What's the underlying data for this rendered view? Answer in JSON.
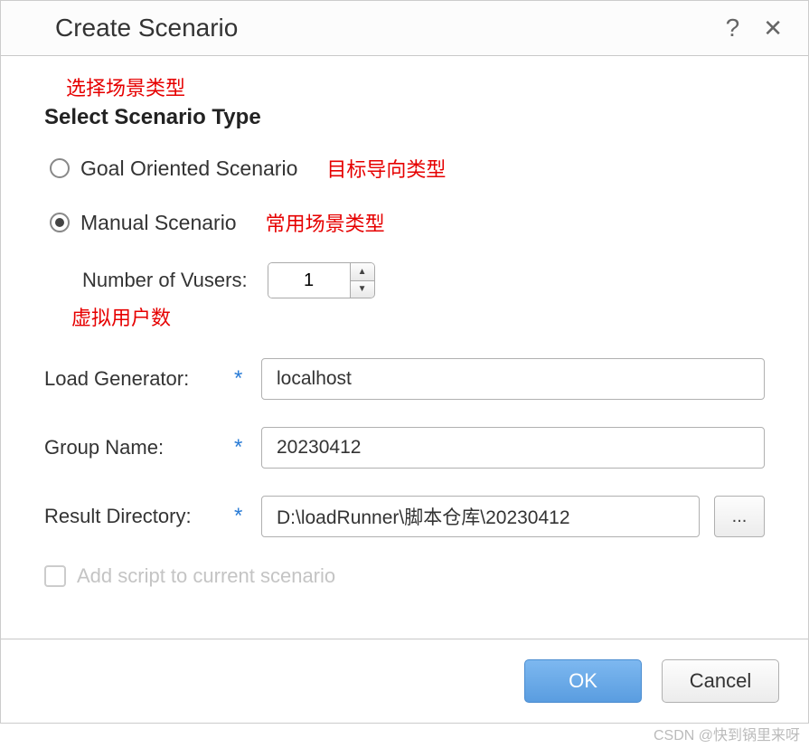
{
  "dialog": {
    "title": "Create Scenario"
  },
  "annotations": {
    "select_type": "选择场景类型",
    "goal_oriented": "目标导向类型",
    "manual": "常用场景类型",
    "vusers": "虚拟用户数"
  },
  "section": {
    "heading": "Select Scenario Type"
  },
  "radios": {
    "goal_label": "Goal Oriented Scenario",
    "manual_label": "Manual Scenario",
    "selected": "manual"
  },
  "vusers": {
    "label": "Number of Vusers:",
    "value": "1"
  },
  "fields": {
    "load_generator": {
      "label": "Load Generator:",
      "value": "localhost"
    },
    "group_name": {
      "label": "Group Name:",
      "value": "20230412"
    },
    "result_directory": {
      "label": "Result Directory:",
      "value": "D:\\loadRunner\\脚本仓库\\20230412"
    },
    "browse_label": "..."
  },
  "checkbox": {
    "label": "Add script to current scenario",
    "checked": false,
    "enabled": false
  },
  "buttons": {
    "ok": "OK",
    "cancel": "Cancel"
  },
  "watermark": "CSDN @快到锅里来呀"
}
